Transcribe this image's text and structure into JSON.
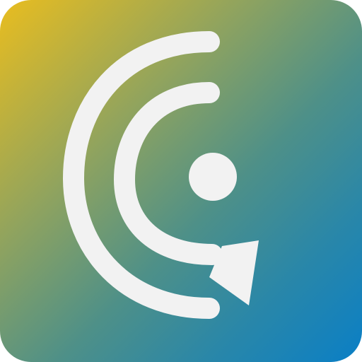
{
  "app_icon": {
    "icon": "chat-broadcast-icon",
    "colors": {
      "gradient_start": "#e9bd1f",
      "gradient_mid": "#4e9088",
      "gradient_end": "#0a7fc6",
      "glyph": "#f2f2f2"
    }
  }
}
